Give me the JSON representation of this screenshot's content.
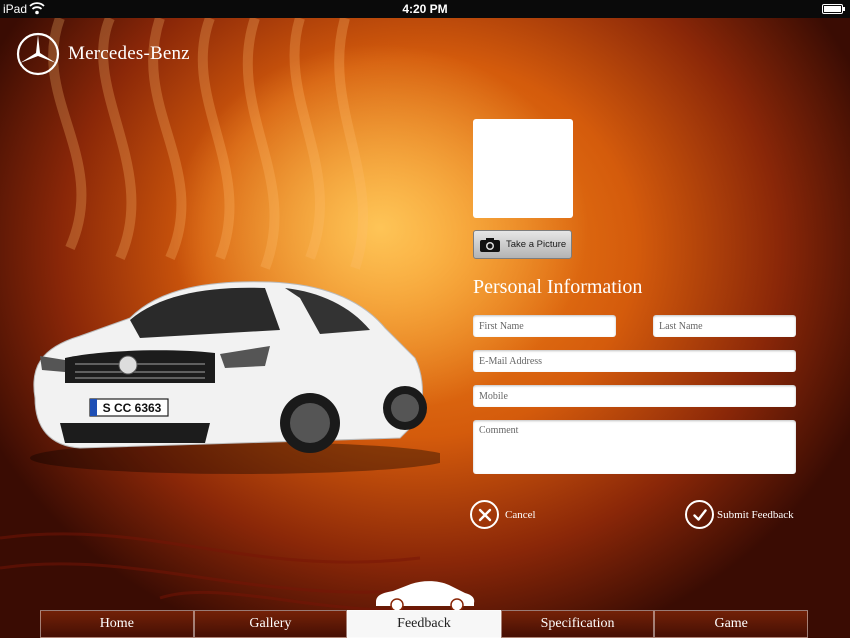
{
  "status_bar": {
    "device": "iPad",
    "time": "4:20 PM",
    "battery_level": 1.0
  },
  "brand": {
    "name": "Mercedes-Benz"
  },
  "car": {
    "plate": "S CC 6363"
  },
  "photo": {
    "button_label": "Take a Picture"
  },
  "form": {
    "title": "Personal Information",
    "first_name_placeholder": "First Name",
    "last_name_placeholder": "Last Name",
    "email_placeholder": "E-Mail Address",
    "mobile_placeholder": "Mobile",
    "comment_placeholder": "Comment",
    "cancel_label": "Cancel",
    "submit_label": "Submit Feedback"
  },
  "nav": {
    "tabs": [
      {
        "label": "Home"
      },
      {
        "label": "Gallery"
      },
      {
        "label": "Feedback"
      },
      {
        "label": "Specification"
      },
      {
        "label": "Game"
      }
    ],
    "active": "Feedback"
  },
  "colors": {
    "accent": "#e0700f",
    "background_dark": "#3a0c03"
  }
}
